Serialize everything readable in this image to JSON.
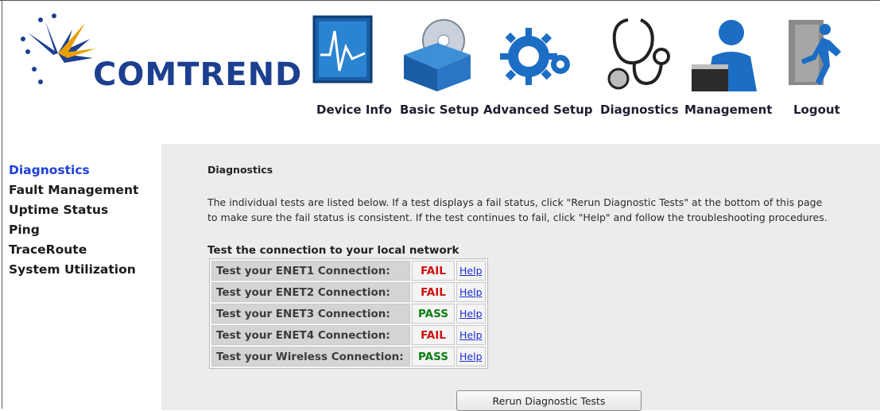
{
  "brand": {
    "name": "COMTREND"
  },
  "nav": {
    "items": [
      {
        "label": "Device Info",
        "icon": "monitor-graph-icon"
      },
      {
        "label": "Basic Setup",
        "icon": "cd-box-icon"
      },
      {
        "label": "Advanced Setup",
        "icon": "gears-icon"
      },
      {
        "label": "Diagnostics",
        "icon": "stethoscope-icon"
      },
      {
        "label": "Management",
        "icon": "person-laptop-icon"
      },
      {
        "label": "Logout",
        "icon": "running-exit-icon"
      }
    ]
  },
  "sidebar": {
    "items": [
      {
        "label": "Diagnostics",
        "active": true
      },
      {
        "label": "Fault Management"
      },
      {
        "label": "Uptime Status"
      },
      {
        "label": "Ping"
      },
      {
        "label": "TraceRoute"
      },
      {
        "label": "System Utilization"
      }
    ]
  },
  "main": {
    "title": "Diagnostics",
    "intro": "The individual tests are listed below. If a test displays a fail status, click \"Rerun Diagnostic Tests\" at the bottom of this page\nto make sure the fail status is consistent. If the test continues to fail, click \"Help\" and follow the troubleshooting procedures.",
    "section_title": "Test the connection to your local network",
    "tests": [
      {
        "label": "Test your ENET1 Connection:",
        "status": "FAIL",
        "help": "Help"
      },
      {
        "label": "Test your ENET2 Connection:",
        "status": "FAIL",
        "help": "Help"
      },
      {
        "label": "Test your ENET3 Connection:",
        "status": "PASS",
        "help": "Help"
      },
      {
        "label": "Test your ENET4 Connection:",
        "status": "FAIL",
        "help": "Help"
      },
      {
        "label": "Test your Wireless Connection:",
        "status": "PASS",
        "help": "Help"
      }
    ],
    "rerun_label": "Rerun Diagnostic Tests"
  },
  "colors": {
    "brand_blue": "#1c3f8f",
    "link_blue": "#1b2bd0",
    "fail_red": "#d10f0f",
    "pass_green": "#0c7d12",
    "content_bg": "#ececec"
  }
}
